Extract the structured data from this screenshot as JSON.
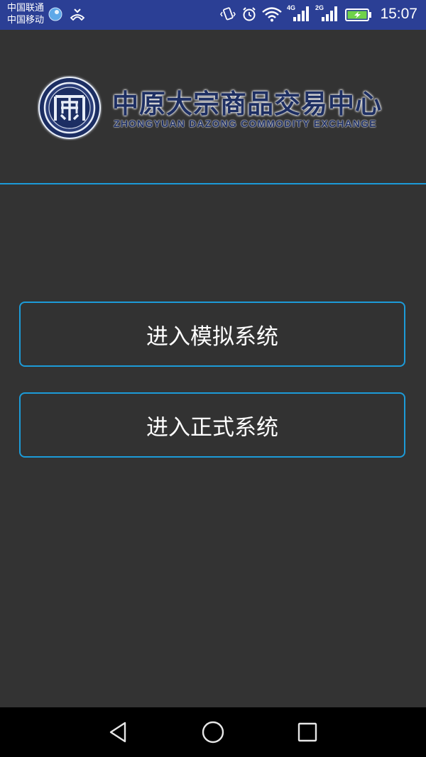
{
  "status_bar": {
    "carrier_1": "中国联通",
    "carrier_2": "中国移动",
    "network_1": "4G",
    "network_2": "2G",
    "time": "15:07",
    "icons": [
      "bubble-icon",
      "missed-call-icon",
      "vibrate-icon",
      "alarm-icon",
      "wifi-icon",
      "signal-4g-icon",
      "signal-2g-icon",
      "battery-charging-icon"
    ]
  },
  "logo": {
    "title": "中原大宗商品交易中心",
    "subtitle": "ZHONGYUAN DAZONG COMMODITY  EXCHANGE"
  },
  "buttons": {
    "simulation": "进入模拟系统",
    "production": "进入正式系统"
  },
  "nav_bar": {
    "icons": [
      "back-icon",
      "home-icon",
      "recent-apps-icon"
    ]
  },
  "colors": {
    "status_bar_bg": "#2b3f95",
    "background": "#333333",
    "accent": "#1c9bd8",
    "logo_navy": "#1e2f63",
    "nav_bar_bg": "#000000"
  }
}
